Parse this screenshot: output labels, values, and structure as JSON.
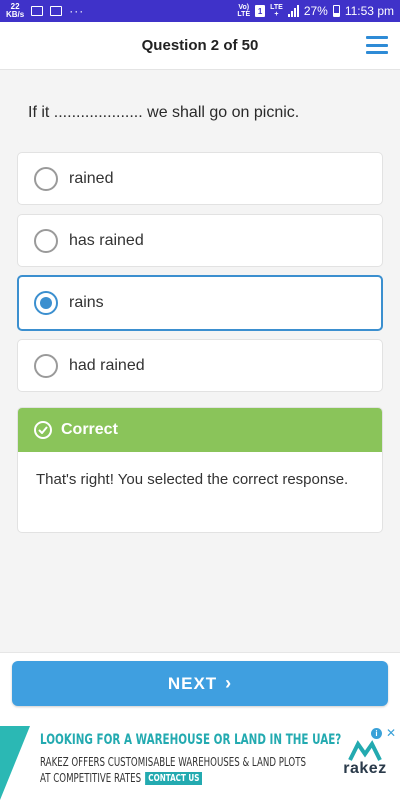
{
  "status_bar": {
    "speed_value": "22",
    "speed_unit": "KB/s",
    "more_dots": "···",
    "volte": "Vo)",
    "volte_sub": "LTE",
    "sim": "1",
    "lte": "LTE",
    "lte_sub": "+",
    "battery": "27%",
    "time": "11:53 pm"
  },
  "header": {
    "title": "Question 2 of 50"
  },
  "question": {
    "text": "If it .................... we shall go on picnic."
  },
  "options": [
    {
      "label": "rained",
      "selected": false
    },
    {
      "label": "has rained",
      "selected": false
    },
    {
      "label": "rains",
      "selected": true
    },
    {
      "label": "had rained",
      "selected": false
    }
  ],
  "feedback": {
    "title": "Correct",
    "body": "That's right! You selected the correct response.",
    "color": "#8ac45a"
  },
  "footer": {
    "next_label": "NEXT",
    "next_color": "#3f9fe0"
  },
  "ad": {
    "headline": "LOOKING FOR A WAREHOUSE OR LAND IN THE UAE?",
    "line1": "RAKEZ OFFERS CUSTOMISABLE WAREHOUSES & LAND PLOTS",
    "line2": "AT COMPETITIVE RATES",
    "cta": "CONTACT US",
    "logo": "rakez",
    "close": "✕",
    "info": "i"
  }
}
